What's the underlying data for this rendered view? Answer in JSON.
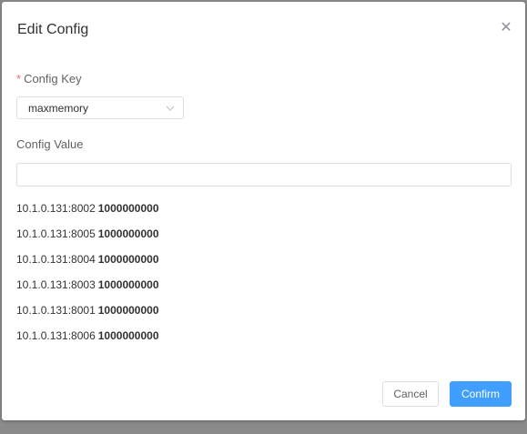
{
  "dialog": {
    "title": "Edit Config",
    "close_icon": "close-icon"
  },
  "config_key": {
    "required_mark": "*",
    "label": "Config Key",
    "selected": "maxmemory",
    "dropdown_icon": "chevron-down-icon"
  },
  "config_value": {
    "label": "Config Value",
    "value": "",
    "placeholder": ""
  },
  "nodes": [
    {
      "address": "10.1.0.131:8002",
      "value": "1000000000"
    },
    {
      "address": "10.1.0.131:8005",
      "value": "1000000000"
    },
    {
      "address": "10.1.0.131:8004",
      "value": "1000000000"
    },
    {
      "address": "10.1.0.131:8003",
      "value": "1000000000"
    },
    {
      "address": "10.1.0.131:8001",
      "value": "1000000000"
    },
    {
      "address": "10.1.0.131:8006",
      "value": "1000000000"
    }
  ],
  "footer": {
    "cancel_label": "Cancel",
    "confirm_label": "Confirm"
  },
  "colors": {
    "primary": "#409eff",
    "required": "#f56c6c"
  }
}
